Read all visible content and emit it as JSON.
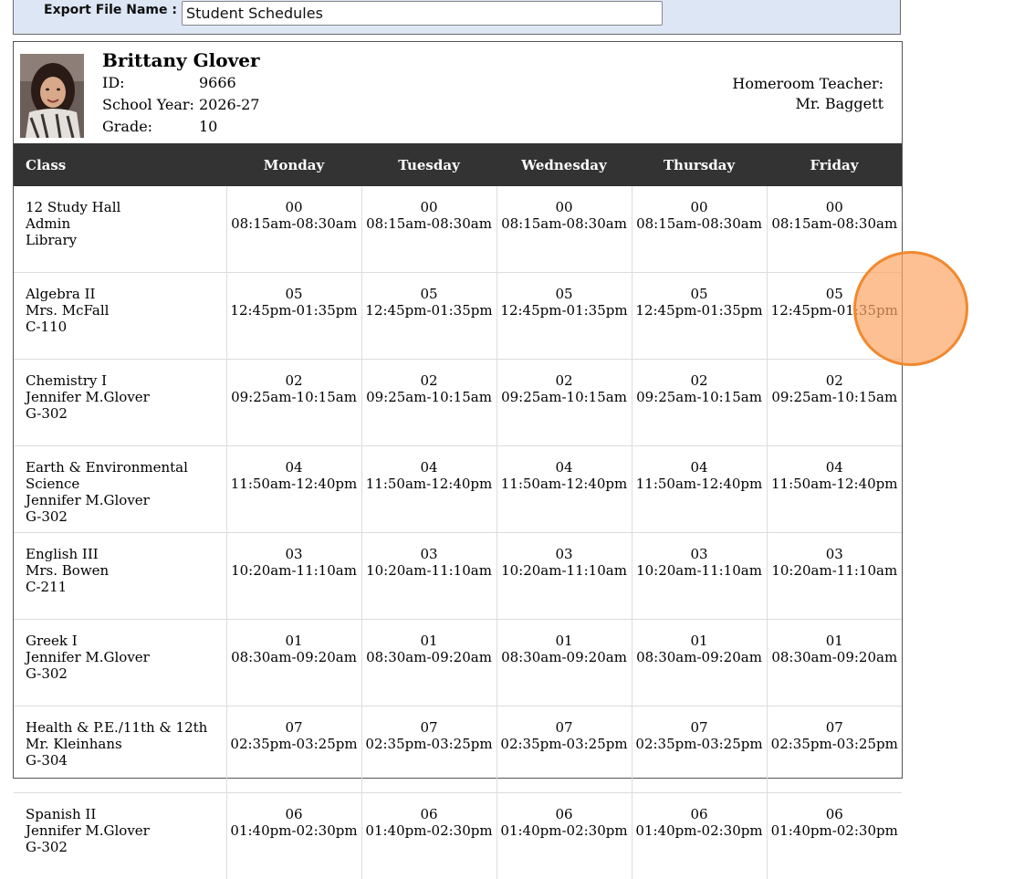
{
  "export": {
    "label": "Export File Name :",
    "value": "Student Schedules"
  },
  "student": {
    "name": "Brittany Glover",
    "id_label": "ID:",
    "id": "9666",
    "year_label": "School Year:",
    "year": "2026-27",
    "grade_label": "Grade:",
    "grade": "10",
    "homeroom_label": "Homeroom Teacher:",
    "homeroom_teacher": "Mr. Baggett"
  },
  "schedule": {
    "headers": [
      "Class",
      "Monday",
      "Tuesday",
      "Wednesday",
      "Thursday",
      "Friday"
    ],
    "rows": [
      {
        "class": "12 Study Hall",
        "teacher": "Admin",
        "room": "Library",
        "period": "00",
        "time": "08:15am-08:30am"
      },
      {
        "class": "Algebra II",
        "teacher": "Mrs. McFall",
        "room": "C-110",
        "period": "05",
        "time": "12:45pm-01:35pm"
      },
      {
        "class": "Chemistry I",
        "teacher": "Jennifer M.Glover",
        "room": "G-302",
        "period": "02",
        "time": "09:25am-10:15am"
      },
      {
        "class": "Earth & Environmental Science",
        "teacher": "Jennifer M.Glover",
        "room": "G-302",
        "period": "04",
        "time": "11:50am-12:40pm"
      },
      {
        "class": "English III",
        "teacher": "Mrs. Bowen",
        "room": "C-211",
        "period": "03",
        "time": "10:20am-11:10am"
      },
      {
        "class": "Greek I",
        "teacher": "Jennifer M.Glover",
        "room": "G-302",
        "period": "01",
        "time": "08:30am-09:20am"
      },
      {
        "class": "Health & P.E./11th & 12th",
        "teacher": "Mr. Kleinhans",
        "room": "G-304",
        "period": "07",
        "time": "02:35pm-03:25pm"
      },
      {
        "class": "Spanish II",
        "teacher": "Jennifer M.Glover",
        "room": "G-302",
        "period": "06",
        "time": "01:40pm-02:30pm"
      }
    ]
  },
  "colors": {
    "header_bg": "#333333",
    "export_bar_bg": "#dce6f5",
    "cursor": "#f0892f"
  }
}
